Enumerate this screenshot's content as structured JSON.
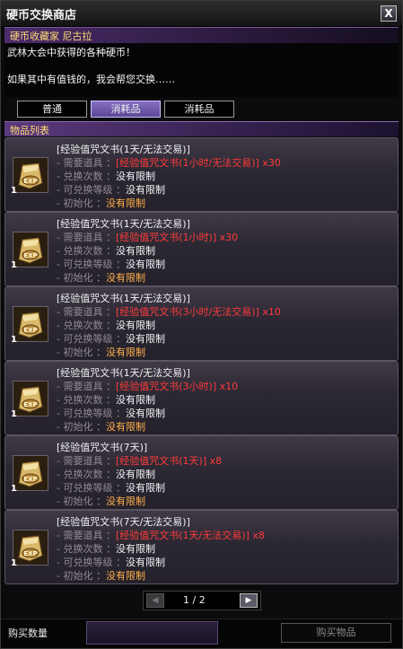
{
  "window": {
    "title": "硬币交换商店",
    "close_label": "X"
  },
  "npc": {
    "name": "硬币收藏家 尼古拉"
  },
  "dialog": {
    "line1": "武林大会中获得的各种硬币！",
    "line2": "如果其中有值钱的，我会帮您交换……"
  },
  "tabs": [
    {
      "label": "普通"
    },
    {
      "label": "消耗品"
    },
    {
      "label": "消耗品"
    }
  ],
  "list_header": "物品列表",
  "field_labels": {
    "required": "- 需要道具 ：",
    "count": "- 兑换次数 ：",
    "level": "- 可兑换等级 ：",
    "init": "- 初始化 ："
  },
  "items": [
    {
      "qty": "1",
      "name": "[经验值咒文书(1天/无法交易)]",
      "required": "[经验值咒文书(1小时/无法交易)] x30",
      "count": "没有限制",
      "level": "没有限制",
      "init": "没有限制"
    },
    {
      "qty": "1",
      "name": "[经验值咒文书(1天/无法交易)]",
      "required": "[经验值咒文书(1小时)] x30",
      "count": "没有限制",
      "level": "没有限制",
      "init": "没有限制"
    },
    {
      "qty": "1",
      "name": "[经验值咒文书(1天/无法交易)]",
      "required": "[经验值咒文书(3小时/无法交易)] x10",
      "count": "没有限制",
      "level": "没有限制",
      "init": "没有限制"
    },
    {
      "qty": "1",
      "name": "[经验值咒文书(1天/无法交易)]",
      "required": "[经验值咒文书(3小时)] x10",
      "count": "没有限制",
      "level": "没有限制",
      "init": "没有限制"
    },
    {
      "qty": "1",
      "name": "[经验值咒文书(7天)]",
      "required": "[经验值咒文书(1天)] x8",
      "count": "没有限制",
      "level": "没有限制",
      "init": "没有限制"
    },
    {
      "qty": "1",
      "name": "[经验值咒文书(7天/无法交易)]",
      "required": "[经验值咒文书(1天/无法交易)] x8",
      "count": "没有限制",
      "level": "没有限制",
      "init": "没有限制"
    }
  ],
  "pager": {
    "text": "1 / 2"
  },
  "bottom": {
    "qty_label": "购买数量",
    "buy_label": "购买物品"
  },
  "colors": {
    "accent_purple": "#5a4694",
    "value_red": "#ff3a3a",
    "value_orange": "#ffb04a",
    "npc_gold": "#ffde70"
  }
}
